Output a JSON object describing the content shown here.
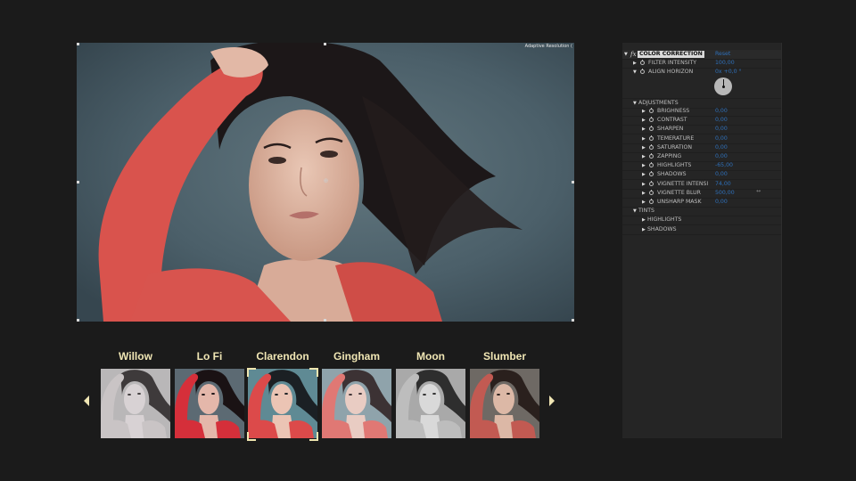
{
  "viewer": {
    "resolution_label": "Adaptive Resolution (",
    "image_description": "Portrait of woman with dark windswept hair wearing red top, hand in hair, blue-grey background"
  },
  "filters": {
    "items": [
      {
        "label": "Willow",
        "tone": "grayscale-warm",
        "selected": false
      },
      {
        "label": "Lo Fi",
        "tone": "high-contrast",
        "selected": false
      },
      {
        "label": "Clarendon",
        "tone": "cool-boost",
        "selected": true
      },
      {
        "label": "Gingham",
        "tone": "faded",
        "selected": false
      },
      {
        "label": "Moon",
        "tone": "grayscale",
        "selected": false
      },
      {
        "label": "Slumber",
        "tone": "warm-faded",
        "selected": false
      }
    ],
    "prev_icon": "triangle-left",
    "next_icon": "triangle-right"
  },
  "colors": {
    "accent_label": "#f0e6b4",
    "value_blue": "#2e6fb8",
    "panel_bg": "#252525",
    "page_bg": "#1b1b1b"
  },
  "effects_panel": {
    "effect_name": "COLOR CORRECTION",
    "reset_label": "Reset",
    "rows": [
      {
        "label": "FILTER INTENSITY",
        "value": "100,00"
      },
      {
        "label": "ALIGN HORIZON",
        "value": "0x +0,0 °"
      }
    ],
    "adjustments": {
      "label": "ADJUSTMENTS",
      "items": [
        {
          "label": "BRIGHNESS",
          "value": "0,00"
        },
        {
          "label": "CONTRAST",
          "value": "0,00"
        },
        {
          "label": "SHARPEN",
          "value": "0,00"
        },
        {
          "label": "TEMERATURE",
          "value": "0,00"
        },
        {
          "label": "SATURATION",
          "value": "0,00"
        },
        {
          "label": "ZAPPING",
          "value": "0,00"
        },
        {
          "label": "HIGHLIGHTS",
          "value": "-65,00"
        },
        {
          "label": "SHADOWS",
          "value": "0,00"
        },
        {
          "label": "VIGNETTE INTENSI",
          "value": "74,00"
        },
        {
          "label": "VIGNETTE BLUR",
          "value": "500,00"
        },
        {
          "label": "UNSHARP MASK",
          "value": "0,00"
        }
      ]
    },
    "tints": {
      "label": "TINTS",
      "items": [
        {
          "label": "HIGHLIGHTS"
        },
        {
          "label": "SHADOWS"
        }
      ]
    }
  }
}
